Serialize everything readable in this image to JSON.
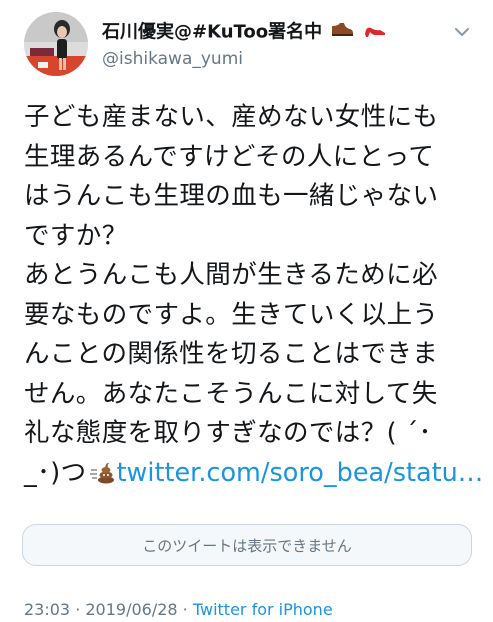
{
  "user": {
    "display_name": "石川優実@#KuToo署名中",
    "handle": "@ishikawa_yumi",
    "name_emoji": [
      "mens-shoe",
      "high-heel"
    ]
  },
  "menu": {
    "icon": "chevron-down-icon"
  },
  "tweet": {
    "lines": [
      "子ども産まない、産めない女性にも",
      "生理あるんですけどその人にとって",
      "はうんこも生理の血も一緒じゃない",
      "ですか？",
      "あとうんこも人間が生きるために必",
      "要なものですよ。生きていく以上う",
      "んことの関係性を切ることはできま",
      "せん。あなたこそうんこに対して失",
      "礼な態度を取りすぎなのでは？( ´･"
    ],
    "last_line_prefix": "_･)つ",
    "last_line_emoji": "poop-emoji",
    "link_text": "twitter.com/soro_bea/statu…"
  },
  "quoted": {
    "unavailable_text": "このツイートは表示できません"
  },
  "meta": {
    "time": "23:03",
    "separator": " · ",
    "date": "2019/06/28",
    "source": "Twitter for iPhone"
  },
  "colors": {
    "text": "#14171a",
    "secondary": "#657786",
    "link": "#1b95e0",
    "border": "#ccd6dd"
  }
}
